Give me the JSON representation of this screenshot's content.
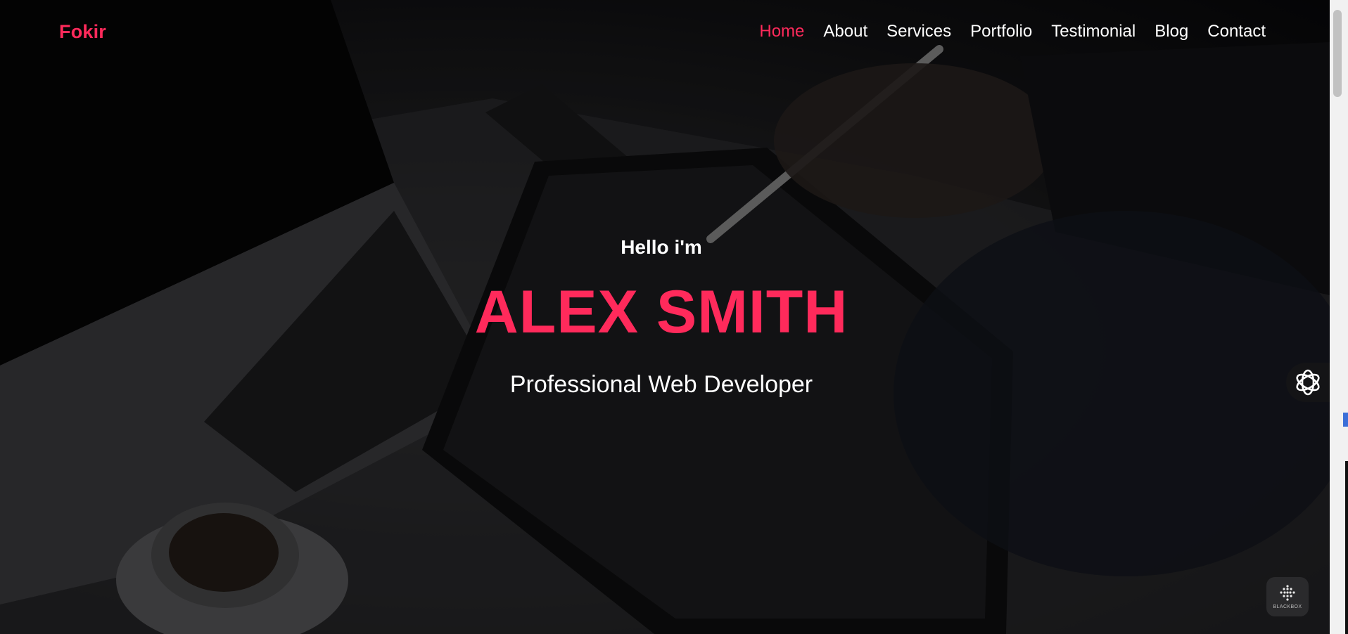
{
  "header": {
    "logo": "Fokir",
    "nav": [
      {
        "label": "Home",
        "active": true
      },
      {
        "label": "About",
        "active": false
      },
      {
        "label": "Services",
        "active": false
      },
      {
        "label": "Portfolio",
        "active": false
      },
      {
        "label": "Testimonial",
        "active": false
      },
      {
        "label": "Blog",
        "active": false
      },
      {
        "label": "Contact",
        "active": false
      }
    ]
  },
  "hero": {
    "greeting": "Hello i'm",
    "name": "ALEX SMITH",
    "role": "Professional Web Developer"
  },
  "widgets": {
    "ai_icon": "openai-knot-icon",
    "blackbox_label": "BLACKBOX",
    "blackbox_icon": "blackbox-dots-icon"
  },
  "colors": {
    "accent": "#ff2a5b",
    "text": "#ffffff",
    "background": "#0b0b0d"
  }
}
